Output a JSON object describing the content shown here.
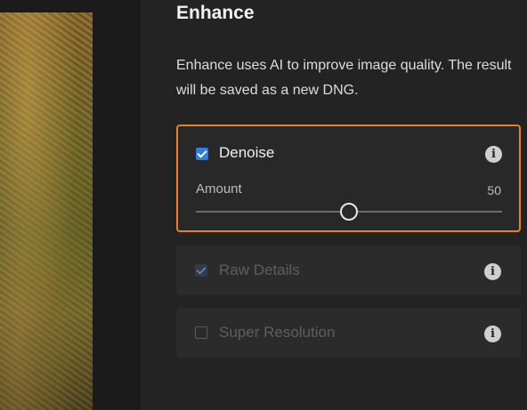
{
  "panel": {
    "title": "Enhance",
    "description": "Enhance uses AI to improve image quality. The result will be saved as a new DNG."
  },
  "options": [
    {
      "label": "Denoise",
      "checked": true,
      "enabled": true,
      "selected": true,
      "amount_label": "Amount",
      "amount_value": "50",
      "amount_fraction": 0.5
    },
    {
      "label": "Raw Details",
      "checked": true,
      "enabled": false
    },
    {
      "label": "Super Resolution",
      "checked": false,
      "enabled": false
    }
  ],
  "colors": {
    "highlight": "#e8821e",
    "checkbox_accent": "#2a7ee0"
  },
  "icons": {
    "info": "info-icon"
  }
}
